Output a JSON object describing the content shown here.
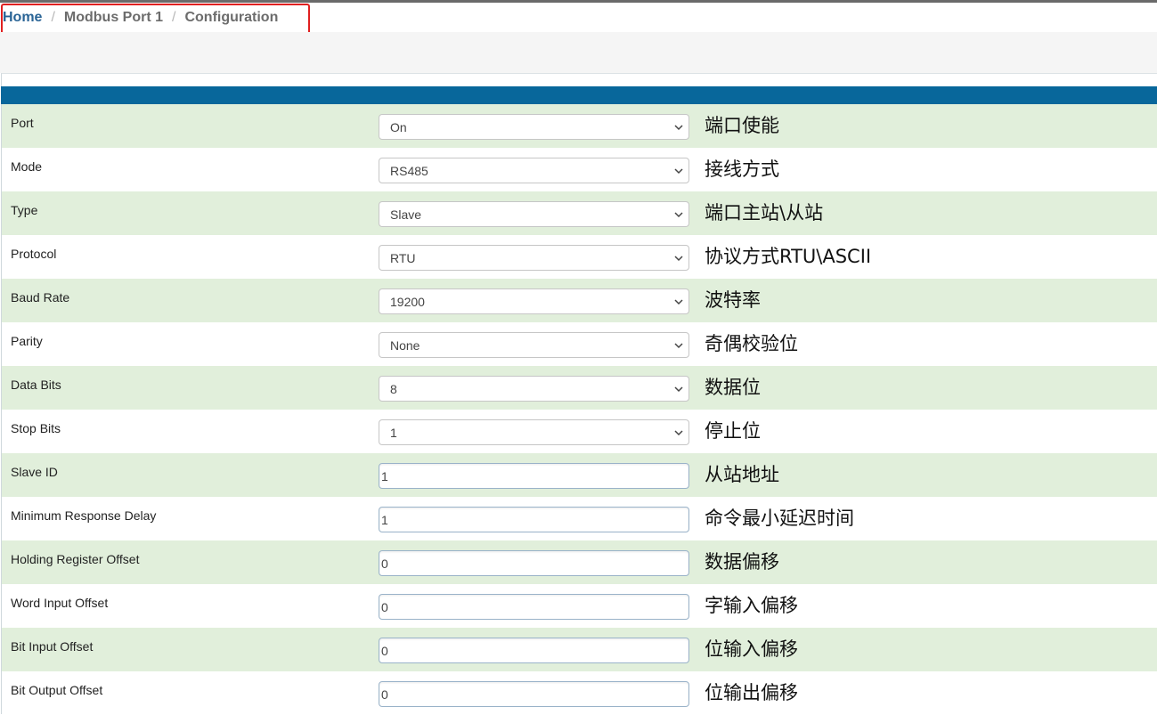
{
  "breadcrumb": {
    "home": "Home",
    "separator": "/",
    "port": "Modbus Port 1",
    "page": "Configuration"
  },
  "colors": {
    "header_bar": "#08679b",
    "row_stripe": "#e1efdb",
    "highlight_box": "#e02020",
    "link": "#2a6496"
  },
  "rows": [
    {
      "label": "Port",
      "kind": "select",
      "value": "On",
      "note": "端口使能"
    },
    {
      "label": "Mode",
      "kind": "select",
      "value": "RS485",
      "note": "接线方式"
    },
    {
      "label": "Type",
      "kind": "select",
      "value": "Slave",
      "note": "端口主站\\从站"
    },
    {
      "label": "Protocol",
      "kind": "select",
      "value": "RTU",
      "note": "协议方式RTU\\ASCII"
    },
    {
      "label": "Baud Rate",
      "kind": "select",
      "value": "19200",
      "note": "波特率"
    },
    {
      "label": "Parity",
      "kind": "select",
      "value": "None",
      "note": "奇偶校验位"
    },
    {
      "label": "Data Bits",
      "kind": "select",
      "value": "8",
      "note": "数据位"
    },
    {
      "label": "Stop Bits",
      "kind": "select",
      "value": "1",
      "note": "停止位"
    },
    {
      "label": "Slave ID",
      "kind": "input",
      "value": "1",
      "note": "从站地址"
    },
    {
      "label": "Minimum Response Delay",
      "kind": "input",
      "value": "1",
      "note": "命令最小延迟时间"
    },
    {
      "label": "Holding Register Offset",
      "kind": "input",
      "value": "0",
      "note": "数据偏移"
    },
    {
      "label": "Word Input Offset",
      "kind": "input",
      "value": "0",
      "note": "字输入偏移"
    },
    {
      "label": "Bit Input Offset",
      "kind": "input",
      "value": "0",
      "note": "位输入偏移"
    },
    {
      "label": "Bit Output Offset",
      "kind": "input",
      "value": "0",
      "note": "位输出偏移"
    }
  ],
  "icons": {
    "dropdown": "chevron-down-icon"
  }
}
